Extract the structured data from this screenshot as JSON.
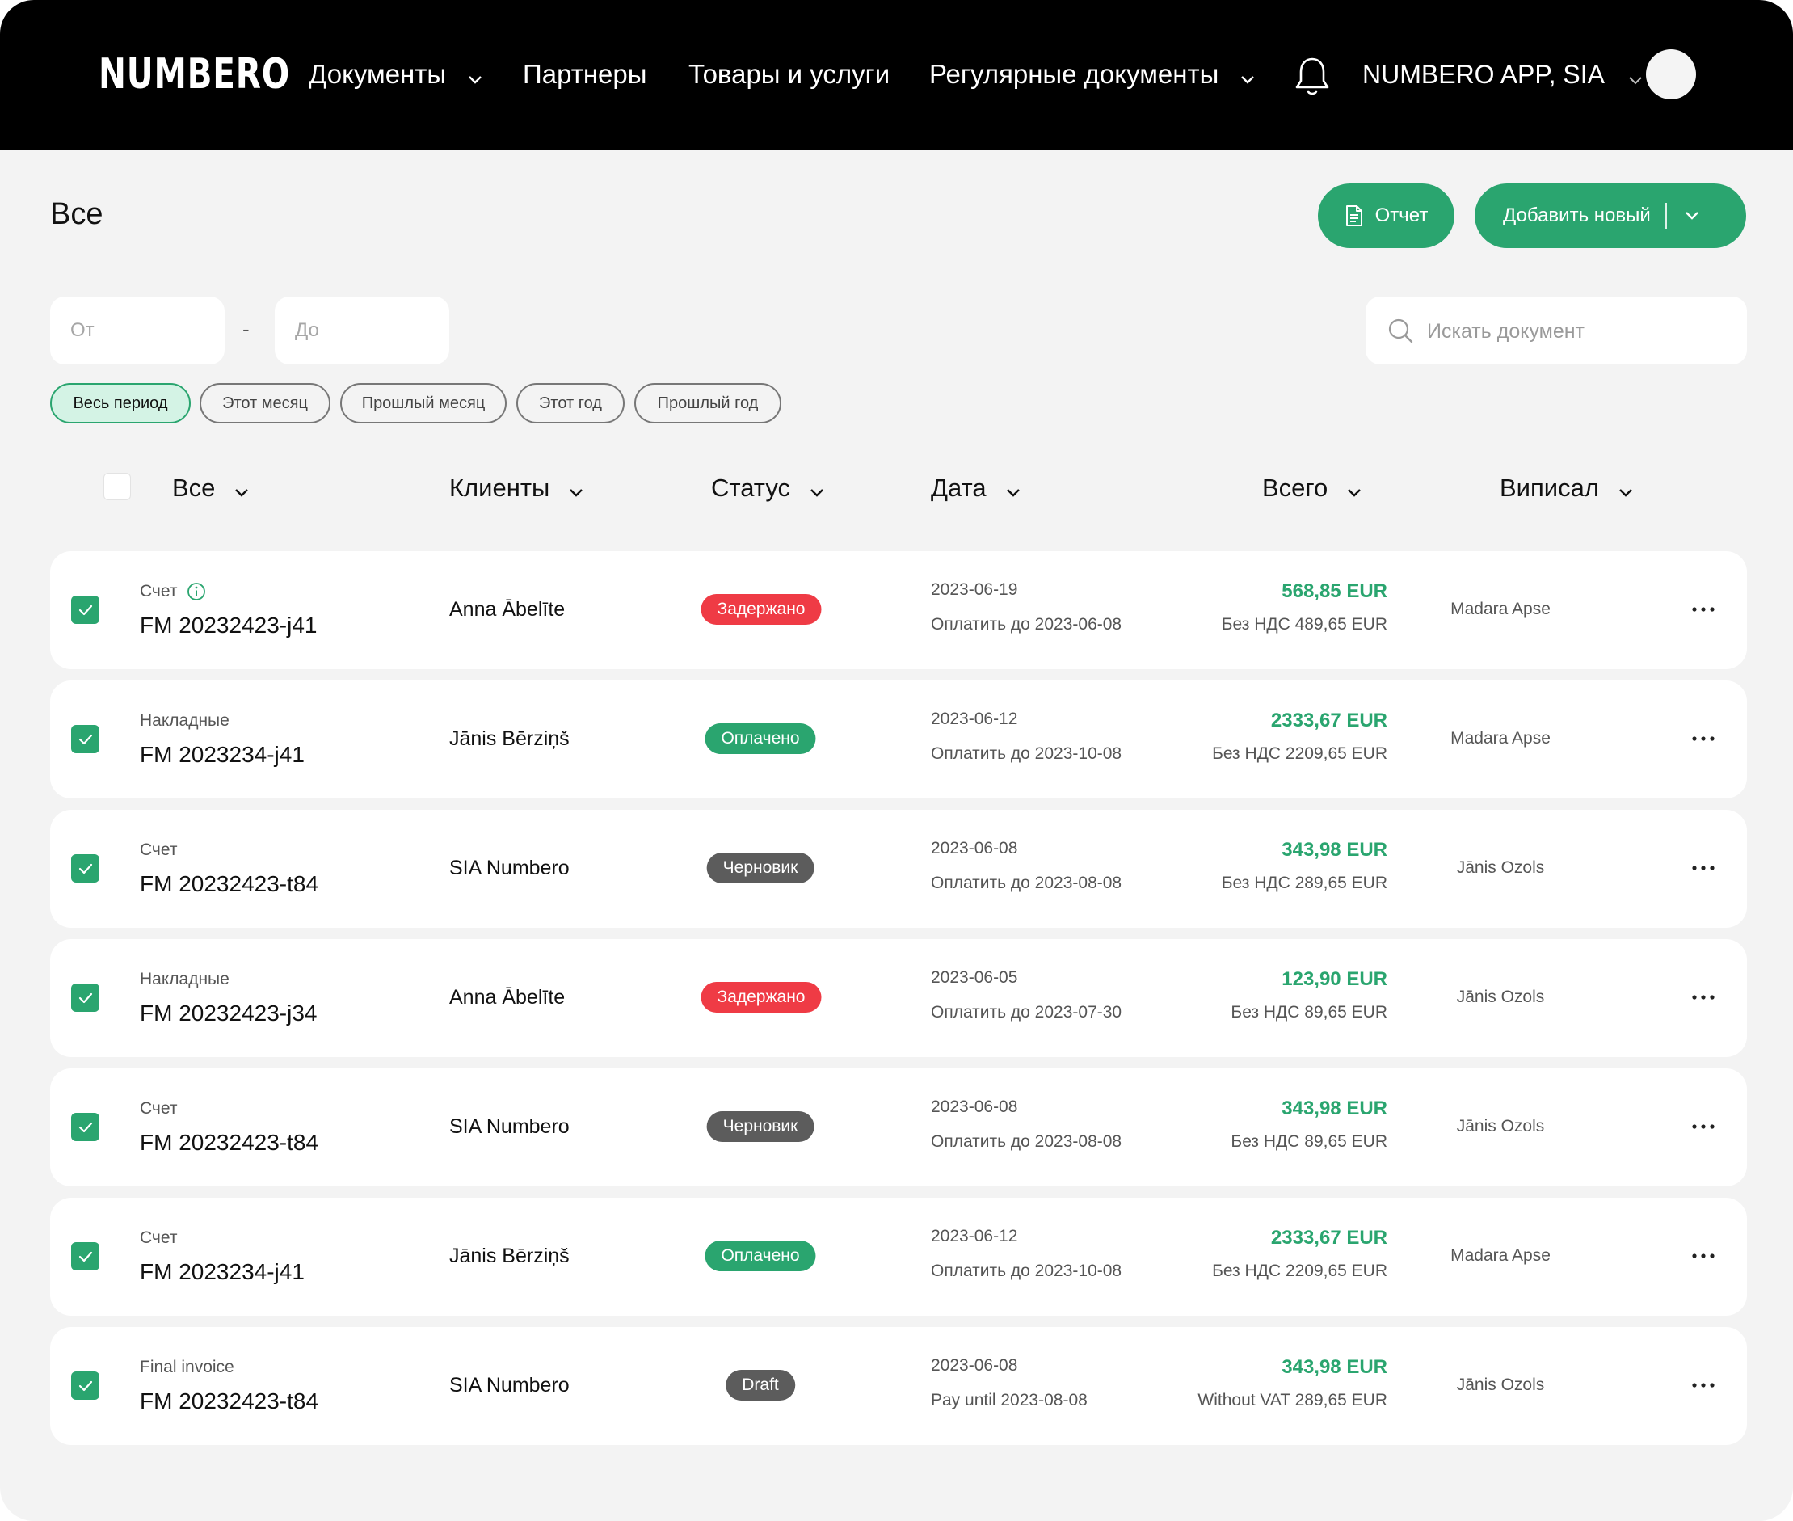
{
  "colors": {
    "topbar": "#000000",
    "accent": "#2aa56f",
    "status_delayed": "#ef3b45",
    "status_paid": "#2aa56f",
    "status_draft": "#5c5c5c",
    "background": "#f3f3f3"
  },
  "brand": {
    "logo": "NUMBERO"
  },
  "nav": {
    "documents": "Документы",
    "partners": "Партнеры",
    "products": "Товары и услуги",
    "recurring": "Регулярные документы"
  },
  "account": {
    "company": "NUMBERO APP, SIA"
  },
  "page": {
    "title": "Все",
    "report_button": "Отчет",
    "add_button": "Добавить новый"
  },
  "filters": {
    "from_placeholder": "От",
    "separator": "-",
    "to_placeholder": "До",
    "search_placeholder": "Искать документ",
    "periods": [
      "Весь период",
      "Этот месяц",
      "Прошлый месяц",
      "Этот год",
      "Прошлый год"
    ],
    "active_period": "Весь период"
  },
  "columns": {
    "all": "Все",
    "clients": "Клиенты",
    "status": "Статус",
    "date": "Дата",
    "total": "Всего",
    "author": "Виписал"
  },
  "rows": [
    {
      "type": "Счет",
      "info_icon": true,
      "number": "FM 20232423-j41",
      "client": "Anna Ābelīte",
      "status": "Задержано",
      "status_kind": "delayed",
      "date": "2023-06-19",
      "due": "Оплатить до 2023-06-08",
      "total": "568,85 EUR",
      "net": "Без НДС 489,65 EUR",
      "author": "Madara Apse",
      "checked": true
    },
    {
      "type": "Накладные",
      "info_icon": false,
      "number": "FM 2023234-j41",
      "client": "Jānis Bērziņš",
      "status": "Оплачено",
      "status_kind": "paid",
      "date": "2023-06-12",
      "due": "Оплатить до 2023-10-08",
      "total": "2333,67 EUR",
      "net": "Без НДС  2209,65 EUR",
      "author": "Madara Apse",
      "checked": true
    },
    {
      "type": "Счет",
      "info_icon": false,
      "number": "FM 20232423-t84",
      "client": "SIA Numbero",
      "status": "Черновик",
      "status_kind": "draft",
      "date": "2023-06-08",
      "due": "Оплатить до  2023-08-08",
      "total": "343,98 EUR",
      "net": "Без НДС  289,65 EUR",
      "author": "Jānis Ozols",
      "checked": true
    },
    {
      "type": "Накладные",
      "info_icon": false,
      "number": "FM 20232423-j34",
      "client": "Anna Ābelīte",
      "status": "Задержано",
      "status_kind": "delayed",
      "date": "2023-06-05",
      "due": "Оплатить до  2023-07-30",
      "total": "123,90 EUR",
      "net": "Без НДС  89,65 EUR",
      "author": "Jānis Ozols",
      "checked": true
    },
    {
      "type": "Счет",
      "info_icon": false,
      "number": "FM 20232423-t84",
      "client": "SIA Numbero",
      "status": "Черновик",
      "status_kind": "draft",
      "date": "2023-06-08",
      "due": "Оплатить до 2023-08-08",
      "total": "343,98 EUR",
      "net": "Без НДС  89,65 EUR",
      "author": "Jānis Ozols",
      "checked": true
    },
    {
      "type": "Счет",
      "info_icon": false,
      "number": "FM 2023234-j41",
      "client": "Jānis Bērziņš",
      "status": "Оплачено",
      "status_kind": "paid",
      "date": "2023-06-12",
      "due": "Оплатить до 2023-10-08",
      "total": "2333,67 EUR",
      "net": "Без НДС 2209,65 EUR",
      "author": "Madara Apse",
      "checked": true
    },
    {
      "type": "Final invoice",
      "info_icon": false,
      "number": "FM 20232423-t84",
      "client": "SIA Numbero",
      "status": "Draft",
      "status_kind": "draft",
      "date": "2023-06-08",
      "due": "Pay until  2023-08-08",
      "total": "343,98 EUR",
      "net": "Without VAT 289,65 EUR",
      "author": "Jānis Ozols",
      "checked": true
    }
  ]
}
